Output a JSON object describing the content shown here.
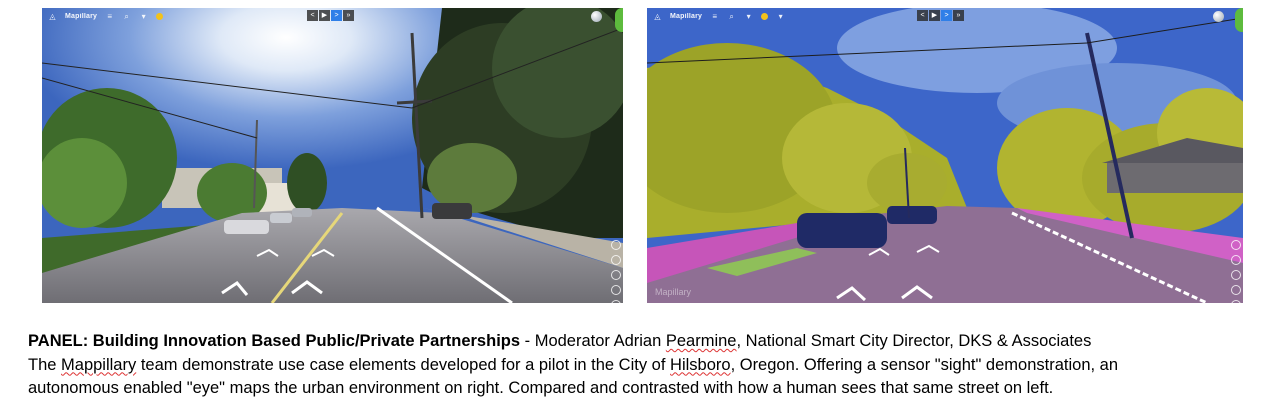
{
  "images": [
    {
      "name": "human-view",
      "toolbar": {
        "brand": "Mapillary",
        "nav": [
          "<",
          "▶",
          ">",
          "»"
        ]
      }
    },
    {
      "name": "segmentation-view",
      "toolbar": {
        "brand": "Mapillary",
        "nav": [
          "<",
          "▶",
          ">",
          "»"
        ]
      },
      "watermark": "Mapillary"
    }
  ],
  "caption": {
    "line1_bold": "PANEL: Building Innovation Based Public/Private Partnerships",
    "line1_pre": " - Moderator Adrian ",
    "line1_name": "Pearmine",
    "line1_post": ", National Smart City Director, DKS & Associates",
    "line2_pre": "The ",
    "line2_mappillary": "Mappillary",
    "line2_mid": " team demonstrate use case elements developed for a pilot in the City of ",
    "line2_city": "Hilsboro",
    "line2_post": ", Oregon. Offering a sensor \"sight\" demonstration, an",
    "line3": "autonomous enabled \"eye\" maps the urban environment on right. Compared and contrasted with how a human sees that same street on left."
  },
  "colors": {
    "sky": "#4a78c6",
    "road": "#8b8a8f",
    "segmentation_vegetation": "#a9ae2c",
    "segmentation_sky": "#3d66c9",
    "segmentation_road": "#8f6f94",
    "segmentation_sidewalk": "#d061c6",
    "segmentation_car": "#1f2a66"
  }
}
